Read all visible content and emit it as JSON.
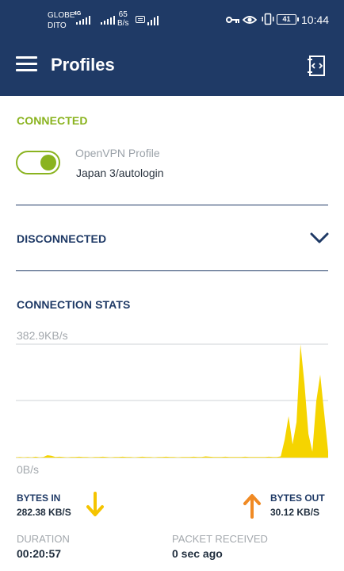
{
  "status_bar": {
    "carrier_line1": "GLOBE",
    "carrier_line2": "DITO",
    "net_type": "4G",
    "speed_value": "65",
    "speed_unit": "B/s",
    "battery": "41",
    "time": "10:44"
  },
  "app_bar": {
    "title": "Profiles",
    "menu_icon": "hamburger-menu-icon",
    "action_icon": "import-profile-icon"
  },
  "connected_section": {
    "label": "CONNECTED",
    "toggle_on": true,
    "profile_type": "OpenVPN Profile",
    "profile_name": "Japan 3/autologin"
  },
  "disconnected_section": {
    "label": "DISCONNECTED",
    "icon": "chevron-down-icon"
  },
  "stats": {
    "label": "CONNECTION STATS",
    "max_label": "382.9KB/s",
    "min_label": "0B/s",
    "bytes_in_title": "BYTES IN",
    "bytes_in_value": "282.38 KB/S",
    "bytes_out_title": "BYTES OUT",
    "bytes_out_value": "30.12 KB/S",
    "duration_title": "DURATION",
    "duration_value": "00:20:57",
    "packet_title": "PACKET RECEIVED",
    "packet_value": "0 sec ago"
  },
  "colors": {
    "primary": "#1f3a66",
    "connected_green": "#8ab31f",
    "chart_yellow": "#f5d400",
    "arrow_in": "#f5c400",
    "arrow_out": "#f08a24"
  },
  "chart_data": {
    "type": "area",
    "ylim": [
      0,
      382.9
    ],
    "yunit": "KB/s",
    "series": [
      {
        "values": [
          1,
          2,
          1,
          2,
          1,
          3,
          1,
          2,
          8,
          6,
          2,
          3,
          2,
          1,
          2,
          2,
          3,
          2,
          2,
          1,
          2,
          2,
          3,
          2,
          1,
          2,
          2,
          3,
          2,
          2,
          1,
          2,
          3,
          2,
          2,
          1,
          2,
          2,
          3,
          2,
          2,
          1,
          2,
          2,
          2,
          3,
          2,
          2,
          4,
          3,
          2,
          2,
          2,
          3,
          2,
          2,
          2,
          2,
          3,
          2,
          2,
          2,
          2,
          2,
          3,
          2,
          2,
          4,
          60,
          140,
          45,
          120,
          382,
          250,
          80,
          20,
          190,
          280,
          150,
          20
        ]
      }
    ]
  }
}
